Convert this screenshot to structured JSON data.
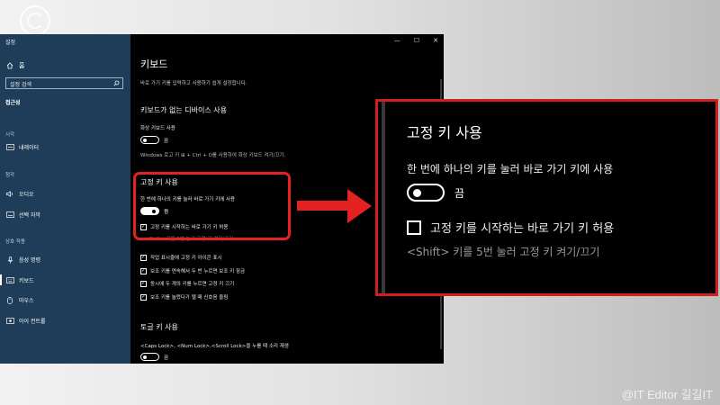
{
  "sidebar": {
    "app_title": "설정",
    "home_label": "홈",
    "search_placeholder": "설정 검색",
    "section_title": "접근성",
    "groups": {
      "vision": "시각",
      "hearing": "청각",
      "interaction": "상호 작용"
    },
    "items": {
      "narrator": "내레이터",
      "audio": "오디오",
      "captions": "선택 자막",
      "speech": "음성 명령",
      "keyboard": "키보드",
      "mouse": "마우스",
      "eye_control": "아이 컨트롤"
    }
  },
  "window": {
    "controls": {
      "minimize": "—",
      "maximize": "☐",
      "close": "✕"
    }
  },
  "content": {
    "title": "키보드",
    "description": "바로 가기 키를 입력하고 사용하기 쉽게 설정합니다.",
    "osk": {
      "heading": "키보드가 없는 디바이스 사용",
      "toggle_label": "화상 키보드 사용",
      "toggle_state": "끔",
      "hint": "Windows 로고 키 ⊞ + Ctrl + O를 사용하여 화상 키보드 켜기/끄기."
    },
    "sticky": {
      "heading": "고정 키 사용",
      "toggle_label": "한 번에 하나의 키를 눌러 바로 가기 키에 사용",
      "toggle_state": "켬",
      "checkbox_label": "고정 키를 시작하는 바로 가기 키 허용",
      "hint": "<Shift> 키를 5번 눌러 고정 키 켜기/끄기"
    },
    "options": [
      "작업 표시줄에 고정 키 아이콘 표시",
      "보조 키를 연속해서 두 번 누르면 보조 키 잠금",
      "동시에 두 개의 키를 누르면 고정 키 끄기",
      "보조 키를 눌렀다가 뗄 때 신호음 울림"
    ],
    "toggle_keys": {
      "heading": "토글 키 사용",
      "description": "<Caps Lock>, <Num Lock>,<Scroll Lock>을 누를 때 소리 재생",
      "toggle_state": "끔"
    }
  },
  "zoom": {
    "heading": "고정 키 사용",
    "toggle_label": "한 번에 하나의 키를 눌러 바로 가기 키에 사용",
    "toggle_state": "끔",
    "checkbox_label": "고정 키를 시작하는 바로 가기 키 허용",
    "hint": "<Shift> 키를 5번 눌러 고정 키 켜기/끄기"
  },
  "watermark": "@IT Editor 길길IT",
  "colors": {
    "sidebar_bg": "#1f3d58",
    "content_bg": "#000000",
    "highlight": "#e52222"
  }
}
